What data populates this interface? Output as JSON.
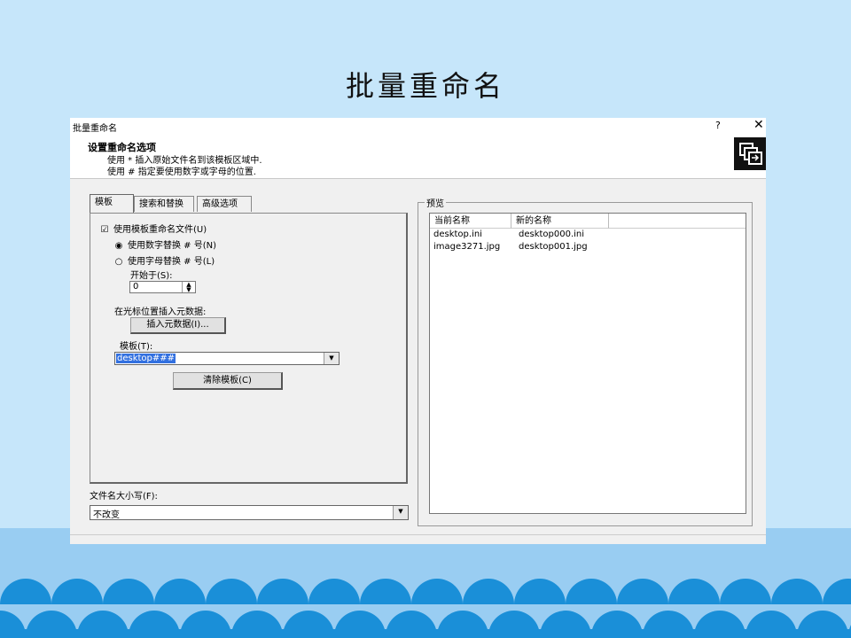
{
  "slide": {
    "title": "批量重命名"
  },
  "dialog": {
    "title": "批量重命名",
    "help": "?",
    "close": "✕",
    "header": {
      "heading": "设置重命名选项",
      "line1": "使用 * 插入原始文件名到该模板区域中.",
      "line2": "使用 # 指定要使用数字或字母的位置."
    },
    "tabs": [
      "模板",
      "搜索和替换",
      "高级选项"
    ],
    "template_tab": {
      "use_template": {
        "label": "使用模板重命名文件(U)",
        "checked": true
      },
      "use_number": {
        "label": "使用数字替换 # 号(N)",
        "checked": true
      },
      "use_letter": {
        "label": "使用字母替换 # 号(L)",
        "checked": false
      },
      "start_at_label": "开始于(S):",
      "start_at_value": "0",
      "insert_meta_label": "在光标位置插入元数据:",
      "insert_meta_button": "插入元数据(I)...",
      "template_label": "模板(T):",
      "template_value": "desktop###",
      "clear_button": "清除模板(C)"
    },
    "case_label": "文件名大小写(F):",
    "case_value": "不改变",
    "preview": {
      "label": "预览",
      "columns": [
        "当前名称",
        "新的名称"
      ],
      "rows": [
        [
          "desktop.ini",
          "desktop000.ini"
        ],
        [
          "image3271.jpg",
          "desktop001.jpg"
        ]
      ]
    }
  },
  "colors": {
    "slide_bg": "#c6e6fa",
    "wave": "#1a8fd8",
    "selection": "#3270e0"
  }
}
